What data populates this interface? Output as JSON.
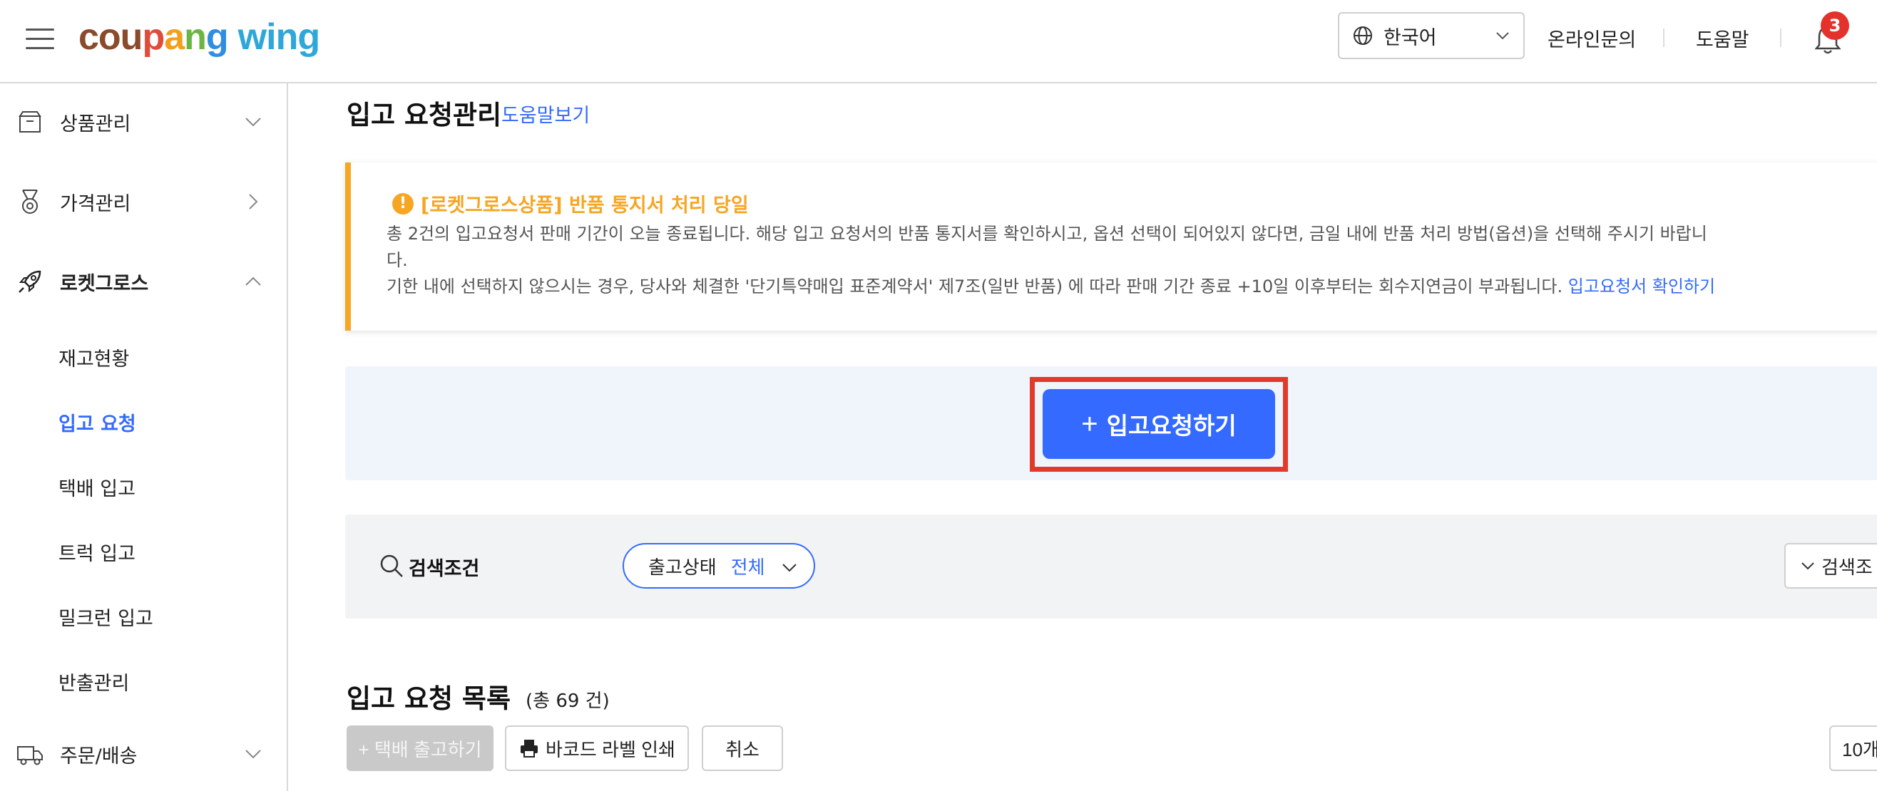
{
  "header": {
    "logo_part1": "cou",
    "logo_part2": "p",
    "logo_part3": "a",
    "logo_part4": "n",
    "logo_part5": "g",
    "logo_wing": "wing",
    "language": "한국어",
    "inquiry": "온라인문의",
    "help": "도움말",
    "notification_count": "3"
  },
  "sidebar": {
    "items": [
      {
        "label": "상품관리",
        "icon": "box-icon"
      },
      {
        "label": "가격관리",
        "icon": "medal-icon"
      },
      {
        "label": "로켓그로스",
        "icon": "rocket-icon"
      },
      {
        "label": "주문/배송",
        "icon": "truck-icon"
      }
    ],
    "sub_items": [
      "재고현황",
      "입고 요청",
      "택배 입고",
      "트럭 입고",
      "밀크런 입고",
      "반출관리"
    ]
  },
  "main": {
    "title": "입고 요청관리",
    "help_link": "도움말보기",
    "notice": {
      "title": "[로켓그로스상품] 반품 통지서 처리 당일",
      "line1": "총 2건의 입고요청서 판매 기간이 오늘 종료됩니다. 해당 입고 요청서의 반품 통지서를 확인하시고, 옵션 선택이 되어있지 않다면, 금일 내에 반품 처리 방법(옵션)을 선택해 주시기 바랍니",
      "line2": "다.",
      "line3": "기한 내에 선택하지 않으시는 경우, 당사와 체결한 '단기특약매입 표준계약서' 제7조(일반 반품) 에 따라 판매 기간 종료 +10일 이후부터는 회수지연금이 부과됩니다.",
      "link": "입고요청서 확인하기"
    },
    "cta_label": "입고요청하기",
    "search": {
      "label": "검색조건",
      "status_key": "출고상태",
      "status_value": "전체",
      "conditions_button": "검색조"
    },
    "list": {
      "title": "입고 요청 목록",
      "count": "(총 69 건)",
      "parcel_button": "+ 택배 출고하기",
      "barcode_button": "바코드 라벨 인쇄",
      "cancel_button": "취소",
      "per_page": "10개"
    }
  },
  "colors": {
    "accent": "#346aff",
    "warning": "#f5a623",
    "highlight": "#e23a2a",
    "badge": "#e5312b"
  }
}
